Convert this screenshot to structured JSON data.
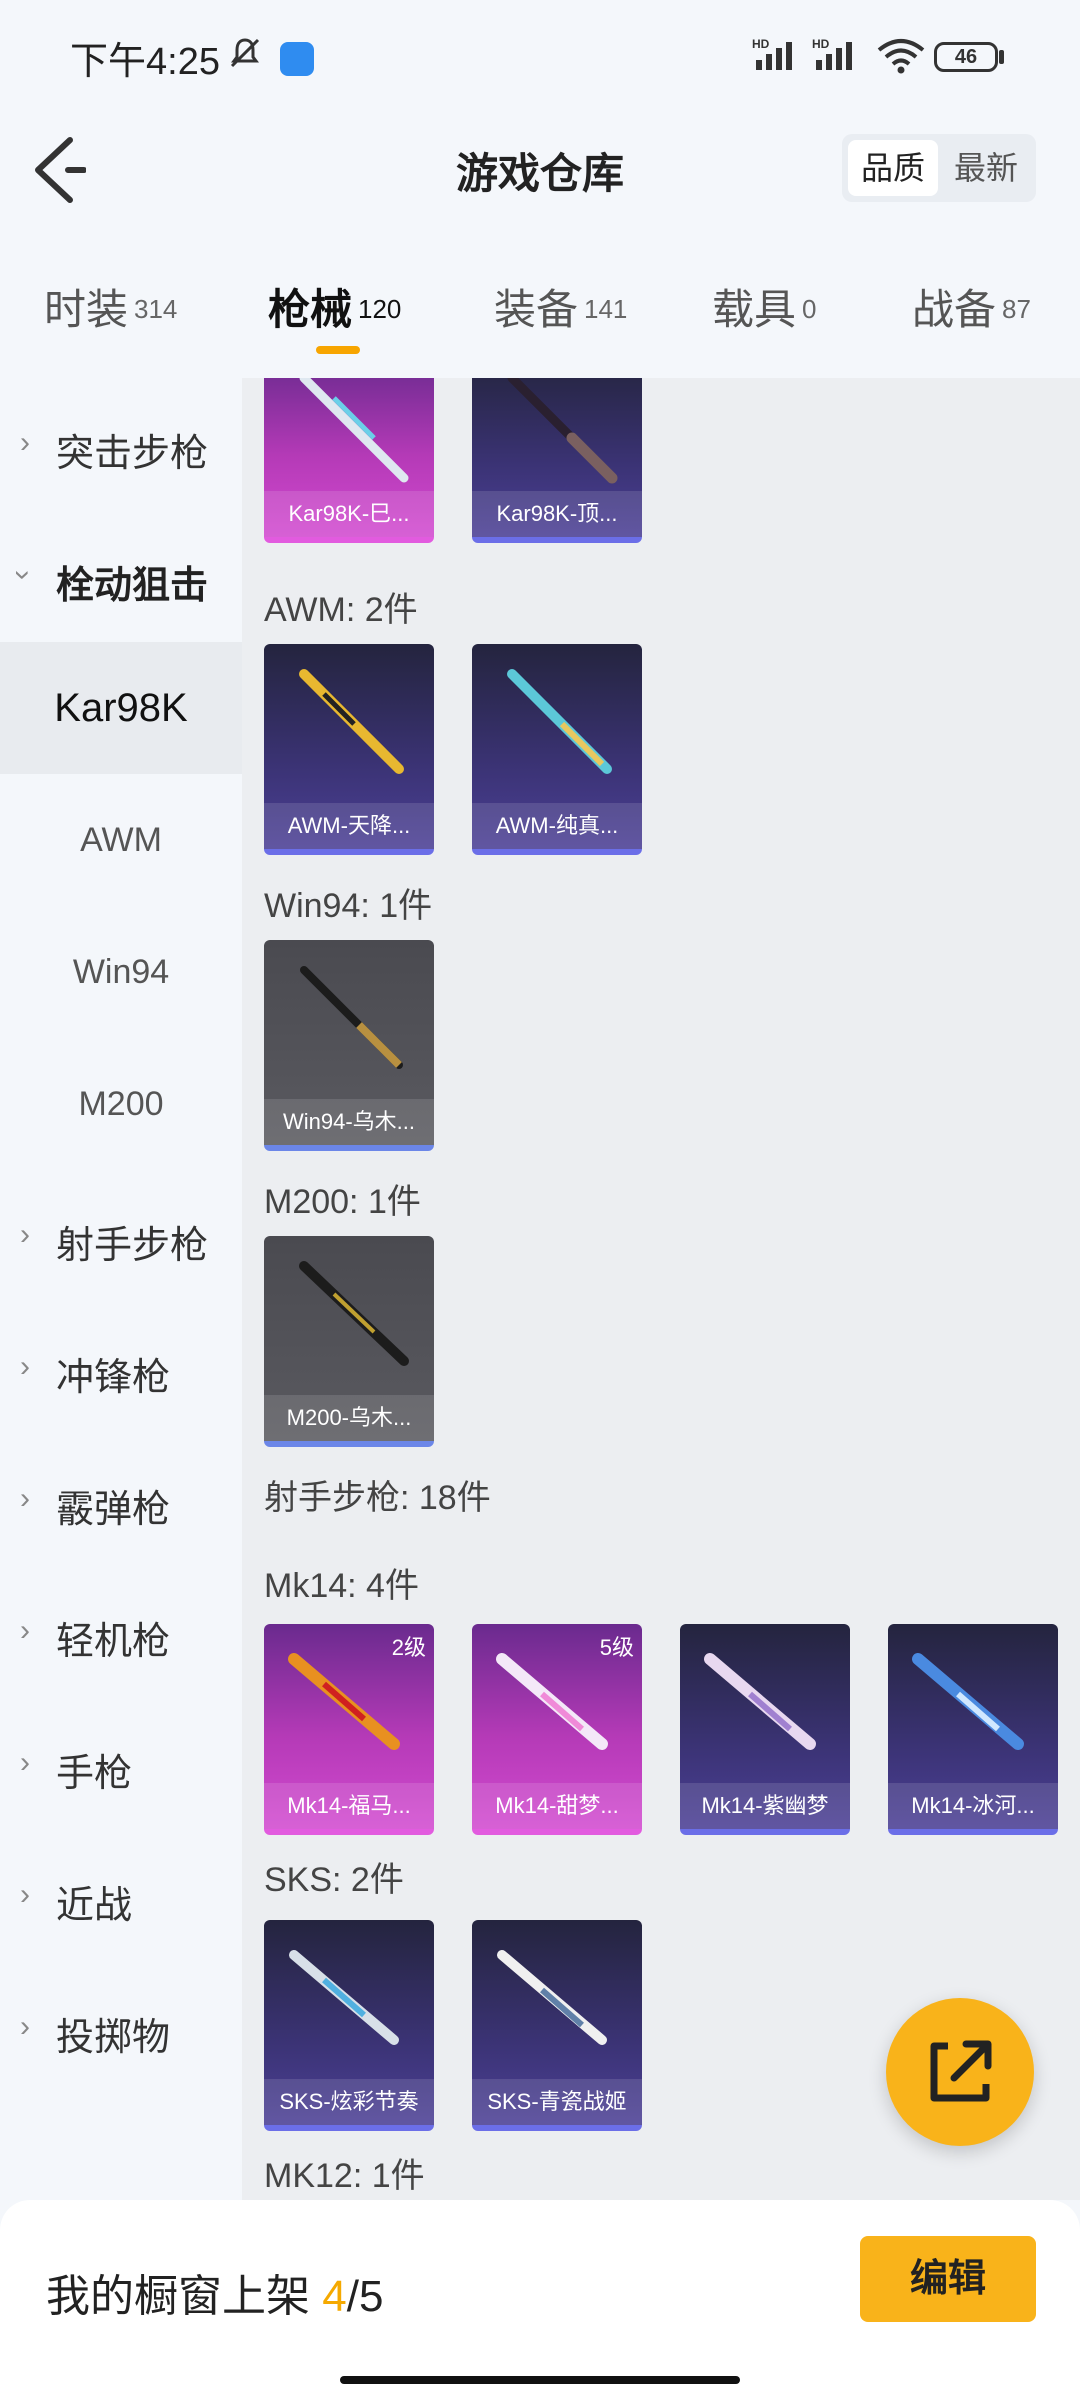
{
  "status_bar": {
    "time": "下午4:25",
    "hd1": "HD",
    "hd2": "HD",
    "battery": "46"
  },
  "header": {
    "title": "游戏仓库",
    "sort_quality": "品质",
    "sort_latest": "最新"
  },
  "tabs": [
    {
      "label": "时装",
      "count": "314"
    },
    {
      "label": "枪械",
      "count": "120"
    },
    {
      "label": "装备",
      "count": "141"
    },
    {
      "label": "载具",
      "count": "0"
    },
    {
      "label": "战备",
      "count": "87"
    }
  ],
  "sidebar": {
    "assault": "突击步枪",
    "bolt": "栓动狙击",
    "sub_kar98k": "Kar98K",
    "sub_awm": "AWM",
    "sub_win94": "Win94",
    "sub_m200": "M200",
    "marksman": "射手步枪",
    "smg": "冲锋枪",
    "shotgun": "霰弹枪",
    "lmg": "轻机枪",
    "pistol": "手枪",
    "melee": "近战",
    "throwable": "投掷物"
  },
  "content": {
    "kar98k_cards": [
      "Kar98K-巳...",
      "Kar98K-顶..."
    ],
    "awm_header": "AWM: 2件",
    "awm_cards": [
      "AWM-天降...",
      "AWM-纯真..."
    ],
    "win94_header": "Win94: 1件",
    "win94_cards": [
      "Win94-乌木..."
    ],
    "m200_header": "M200: 1件",
    "m200_cards": [
      "M200-乌木..."
    ],
    "marksman_header": "射手步枪: 18件",
    "mk14_header": "Mk14: 4件",
    "mk14_cards": [
      {
        "name": "Mk14-福马...",
        "level": "2级"
      },
      {
        "name": "Mk14-甜梦...",
        "level": "5级"
      },
      {
        "name": "Mk14-紫幽梦",
        "level": ""
      },
      {
        "name": "Mk14-冰河...",
        "level": ""
      }
    ],
    "sks_header": "SKS: 2件",
    "sks_cards": [
      "SKS-炫彩节奏",
      "SKS-青瓷战姬"
    ],
    "mk12_header": "MK12: 1件"
  },
  "bottom": {
    "shelf_prefix": "我的橱窗上架 ",
    "shelf_current": "4",
    "shelf_total": "/5",
    "edit": "编辑"
  },
  "icons": {
    "back": "back-arrow-icon",
    "fab": "share-export-icon",
    "bell": "bell-muted-icon",
    "wifi": "wifi-icon",
    "signal": "signal-icon"
  }
}
